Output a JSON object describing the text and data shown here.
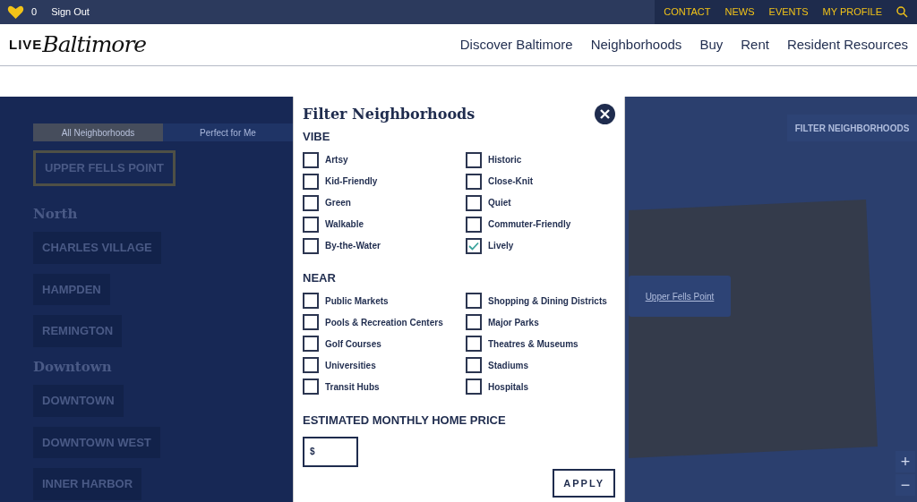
{
  "top_bar": {
    "favorites_count": "0",
    "sign_out": "Sign Out",
    "links": [
      "CONTACT",
      "NEWS",
      "EVENTS",
      "MY PROFILE"
    ]
  },
  "header": {
    "logo_prefix": "LIVE",
    "logo_script": "Baltimore",
    "nav": [
      "Discover Baltimore",
      "Neighborhoods",
      "Buy",
      "Rent",
      "Resident Resources"
    ]
  },
  "sidebar": {
    "tabs": [
      {
        "label": "All Neighborhoods",
        "selected": true
      },
      {
        "label": "Perfect for Me",
        "selected": false
      }
    ],
    "current": "UPPER FELLS POINT",
    "groups": [
      {
        "heading": "North",
        "items": [
          "CHARLES VILLAGE",
          "HAMPDEN",
          "REMINGTON"
        ]
      },
      {
        "heading": "Downtown",
        "items": [
          "DOWNTOWN",
          "DOWNTOWN WEST",
          "INNER HARBOR"
        ]
      }
    ]
  },
  "filter_dialog": {
    "title": "Filter Neighborhoods",
    "sections": [
      {
        "heading": "VIBE",
        "options": [
          {
            "label": "Artsy",
            "checked": false
          },
          {
            "label": "Kid-Friendly",
            "checked": false
          },
          {
            "label": "Green",
            "checked": false
          },
          {
            "label": "Walkable",
            "checked": false
          },
          {
            "label": "By-the-Water",
            "checked": false
          },
          {
            "label": "Historic",
            "checked": false
          },
          {
            "label": "Close-Knit",
            "checked": false
          },
          {
            "label": "Quiet",
            "checked": false
          },
          {
            "label": "Commuter-Friendly",
            "checked": false
          },
          {
            "label": "Lively",
            "checked": true
          }
        ]
      },
      {
        "heading": "NEAR",
        "options": [
          {
            "label": "Public Markets",
            "checked": false
          },
          {
            "label": "Pools & Recreation Centers",
            "checked": false
          },
          {
            "label": "Golf Courses",
            "checked": false
          },
          {
            "label": "Universities",
            "checked": false
          },
          {
            "label": "Transit Hubs",
            "checked": false
          },
          {
            "label": "Shopping & Dining Districts",
            "checked": false
          },
          {
            "label": "Major Parks",
            "checked": false
          },
          {
            "label": "Theatres & Museums",
            "checked": false
          },
          {
            "label": "Stadiums",
            "checked": false
          },
          {
            "label": "Hospitals",
            "checked": false
          }
        ]
      }
    ],
    "price": {
      "heading": "ESTIMATED MONTHLY HOME PRICE",
      "placeholder": "$"
    },
    "apply": "APPLY"
  },
  "map": {
    "filter_button": "FILTER NEIGHBORHOODS",
    "popup_link": "Upper Fells Point",
    "zoom_in": "+",
    "zoom_out": "−"
  }
}
